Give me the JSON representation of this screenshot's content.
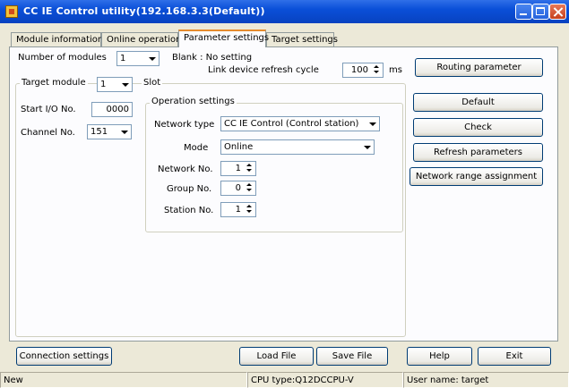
{
  "window": {
    "title": "CC IE Control utility(192.168.3.3(Default))"
  },
  "tabs": [
    "Module information",
    "Online operation",
    "Parameter settings",
    "Target settings"
  ],
  "module_count": {
    "label": "Number of modules",
    "value": "1"
  },
  "blank_note": "Blank : No setting",
  "refresh": {
    "label": "Link device refresh cycle",
    "value": "100",
    "unit": "ms"
  },
  "target_module": {
    "label": "Target module",
    "value": "1"
  },
  "slot_label": "Slot",
  "start_io": {
    "label": "Start I/O No.",
    "value": "0000"
  },
  "channel": {
    "label": "Channel No.",
    "value": "151"
  },
  "operation": {
    "title": "Operation settings",
    "network_type": {
      "label": "Network type",
      "value": "CC IE Control (Control station)"
    },
    "mode": {
      "label": "Mode",
      "value": "Online"
    },
    "network_no": {
      "label": "Network No.",
      "value": "1"
    },
    "group_no": {
      "label": "Group No.",
      "value": "0"
    },
    "station_no": {
      "label": "Station No.",
      "value": "1"
    }
  },
  "buttons": {
    "routing": "Routing parameter",
    "default": "Default",
    "check": "Check",
    "refresh_params": "Refresh parameters",
    "network_range": "Network range assignment",
    "connection": "Connection settings",
    "load": "Load File",
    "save": "Save File",
    "help": "Help",
    "exit": "Exit"
  },
  "status": {
    "mode": "New",
    "cpu": "CPU type:Q12DCCPU-V",
    "user": "User name: target"
  }
}
